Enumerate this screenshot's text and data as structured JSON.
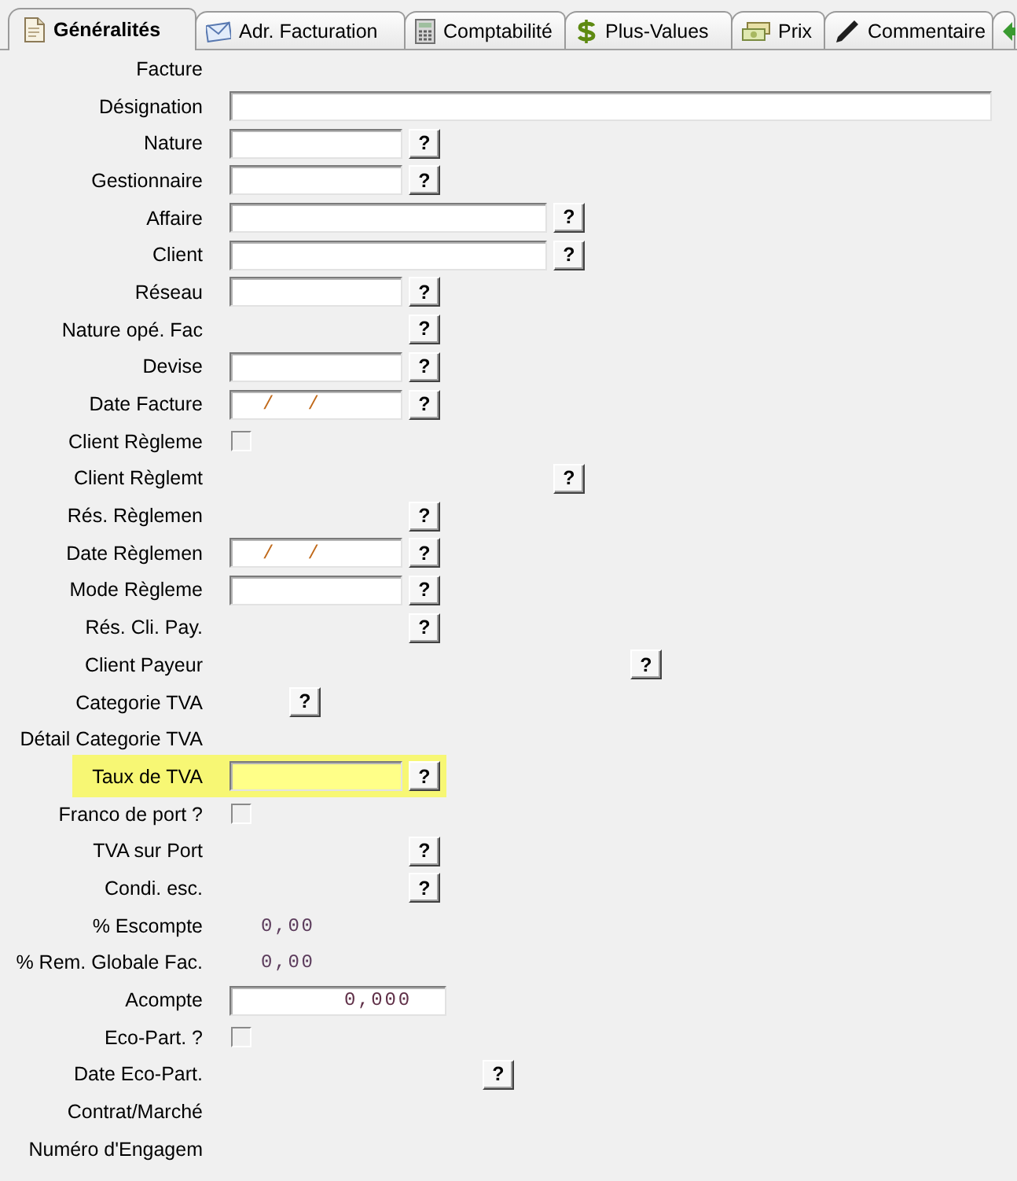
{
  "tabs": [
    {
      "label": "Généralités",
      "selected": true
    },
    {
      "label": "Adr. Facturation",
      "selected": false
    },
    {
      "label": "Comptabilité",
      "selected": false
    },
    {
      "label": "Plus-Values",
      "selected": false
    },
    {
      "label": "Prix",
      "selected": false
    },
    {
      "label": "Commentaire",
      "selected": false
    },
    {
      "selected": false
    }
  ],
  "rows": [
    {
      "label": "Facture",
      "kind": "label-only",
      "highlighted": false
    },
    {
      "label": "Désignation",
      "kind": "text-field",
      "highlighted": false
    },
    {
      "label": "Nature",
      "kind": "text-field",
      "button": "?",
      "highlighted": false
    },
    {
      "label": "Gestionnaire",
      "kind": "text-field",
      "button": "?",
      "highlighted": false
    },
    {
      "label": "Affaire",
      "kind": "text-field",
      "button": "?",
      "highlighted": false
    },
    {
      "label": "Client",
      "kind": "text-field",
      "button": "?",
      "highlighted": false
    },
    {
      "label": "Réseau",
      "kind": "text-field",
      "button": "?",
      "highlighted": false
    },
    {
      "label": "Nature opé. Fac",
      "kind": "lookup",
      "button": "?",
      "highlighted": false
    },
    {
      "label": "Devise",
      "kind": "text-field",
      "button": "?",
      "highlighted": false
    },
    {
      "label": "Date Facture",
      "kind": "date-field",
      "value": "/   /",
      "button": "?",
      "highlighted": false
    },
    {
      "label": "Client Règleme",
      "kind": "checkbox",
      "checked": false,
      "highlighted": false
    },
    {
      "label": "Client Règlemt",
      "kind": "lookup",
      "button": "?",
      "highlighted": false
    },
    {
      "label": "Rés. Règlemen",
      "kind": "lookup",
      "button": "?",
      "highlighted": false
    },
    {
      "label": "Date Règlemen",
      "kind": "date-field",
      "value": "/   /",
      "button": "?",
      "highlighted": false
    },
    {
      "label": "Mode Règleme",
      "kind": "text-field",
      "button": "?",
      "highlighted": false
    },
    {
      "label": "Rés. Cli. Pay.",
      "kind": "lookup",
      "button": "?",
      "highlighted": false
    },
    {
      "label": "Client Payeur",
      "kind": "lookup",
      "button": "?",
      "highlighted": false
    },
    {
      "label": "Categorie TVA",
      "kind": "lookup",
      "button": "?",
      "highlighted": false
    },
    {
      "label": "Détail Categorie TVA",
      "kind": "label-only",
      "highlighted": false
    },
    {
      "label": "Taux de TVA",
      "kind": "text-field",
      "button": "?",
      "highlighted": true
    },
    {
      "label": "Franco de port ?",
      "kind": "checkbox",
      "checked": false,
      "highlighted": false
    },
    {
      "label": "TVA sur Port",
      "kind": "lookup",
      "button": "?",
      "highlighted": false
    },
    {
      "label": "Condi. esc.",
      "kind": "lookup",
      "button": "?",
      "highlighted": false
    },
    {
      "label": "% Escompte",
      "kind": "value",
      "value": "0,00",
      "highlighted": false
    },
    {
      "label": "% Rem. Globale Fac.",
      "kind": "value",
      "value": "0,00",
      "highlighted": false
    },
    {
      "label": "Acompte",
      "kind": "amount-field",
      "value": "0,000",
      "highlighted": false
    },
    {
      "label": "Eco-Part. ?",
      "kind": "checkbox",
      "checked": false,
      "highlighted": false
    },
    {
      "label": "Date Eco-Part.",
      "kind": "lookup",
      "button": "?",
      "highlighted": false
    },
    {
      "label": "Contrat/Marché",
      "kind": "label-only",
      "highlighted": false
    },
    {
      "label": "Numéro d'Engagem",
      "kind": "label-only",
      "highlighted": false
    }
  ]
}
